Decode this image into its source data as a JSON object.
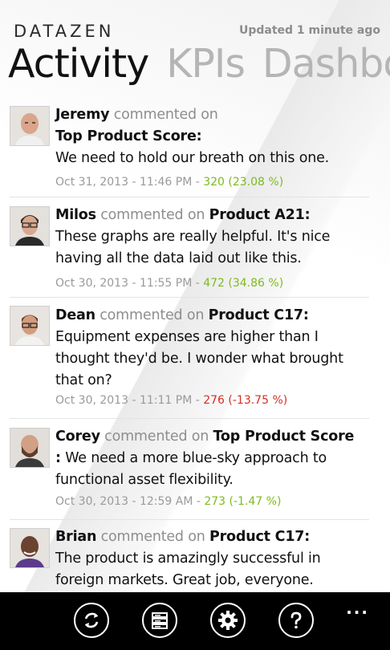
{
  "header": {
    "brand": "DATAZEN",
    "updated": "Updated 1 minute ago"
  },
  "pivots": [
    "Activity",
    "KPIs",
    "Dashbo"
  ],
  "feed": [
    {
      "user": "Jeremy",
      "verb": "commented on",
      "target": "Top Product Score:",
      "comment": "We need to hold our breath on this one.",
      "date": "Oct 31, 2013 - 11:46 PM - ",
      "value": "320 (23.08 %)",
      "trend": "positive"
    },
    {
      "user": "Milos",
      "verb": "commented on",
      "target": "Product A21:",
      "comment": "These graphs are really helpful. It's nice having all the data laid out like this.",
      "date": "Oct 30, 2013 - 11:55 PM - ",
      "value": "472 (34.86 %)",
      "trend": "positive"
    },
    {
      "user": "Dean",
      "verb": "commented on",
      "target": "Product C17:",
      "comment": "Equipment expenses are higher than I thought they'd be. I wonder what brought that on?",
      "date": "Oct 30, 2013 - 11:11 PM - ",
      "value": "276 (-13.75 %)",
      "trend": "negative"
    },
    {
      "user": "Corey",
      "verb": "commented on",
      "target": "Top Product Score",
      "colon": ":",
      "comment": "We need a more blue-sky approach to functional asset flexibility.",
      "date": "Oct 30, 2013 - 12:59 AM - ",
      "value": "273 (-1.47 %)",
      "trend": "positive"
    },
    {
      "user": "Brian",
      "verb": "commented on",
      "target": "Product C17:",
      "comment": "The product is amazingly successful in foreign markets. Great job, everyone.",
      "trend": "positive"
    }
  ],
  "appbar": {
    "buttons": [
      "refresh-icon",
      "server-icon",
      "gear-icon",
      "help-icon"
    ],
    "more": "..."
  },
  "colors": {
    "positive": "#7dbb1e",
    "negative": "#d43023",
    "pivot_inactive": "#b5b5b5",
    "appbar": "#000000"
  }
}
